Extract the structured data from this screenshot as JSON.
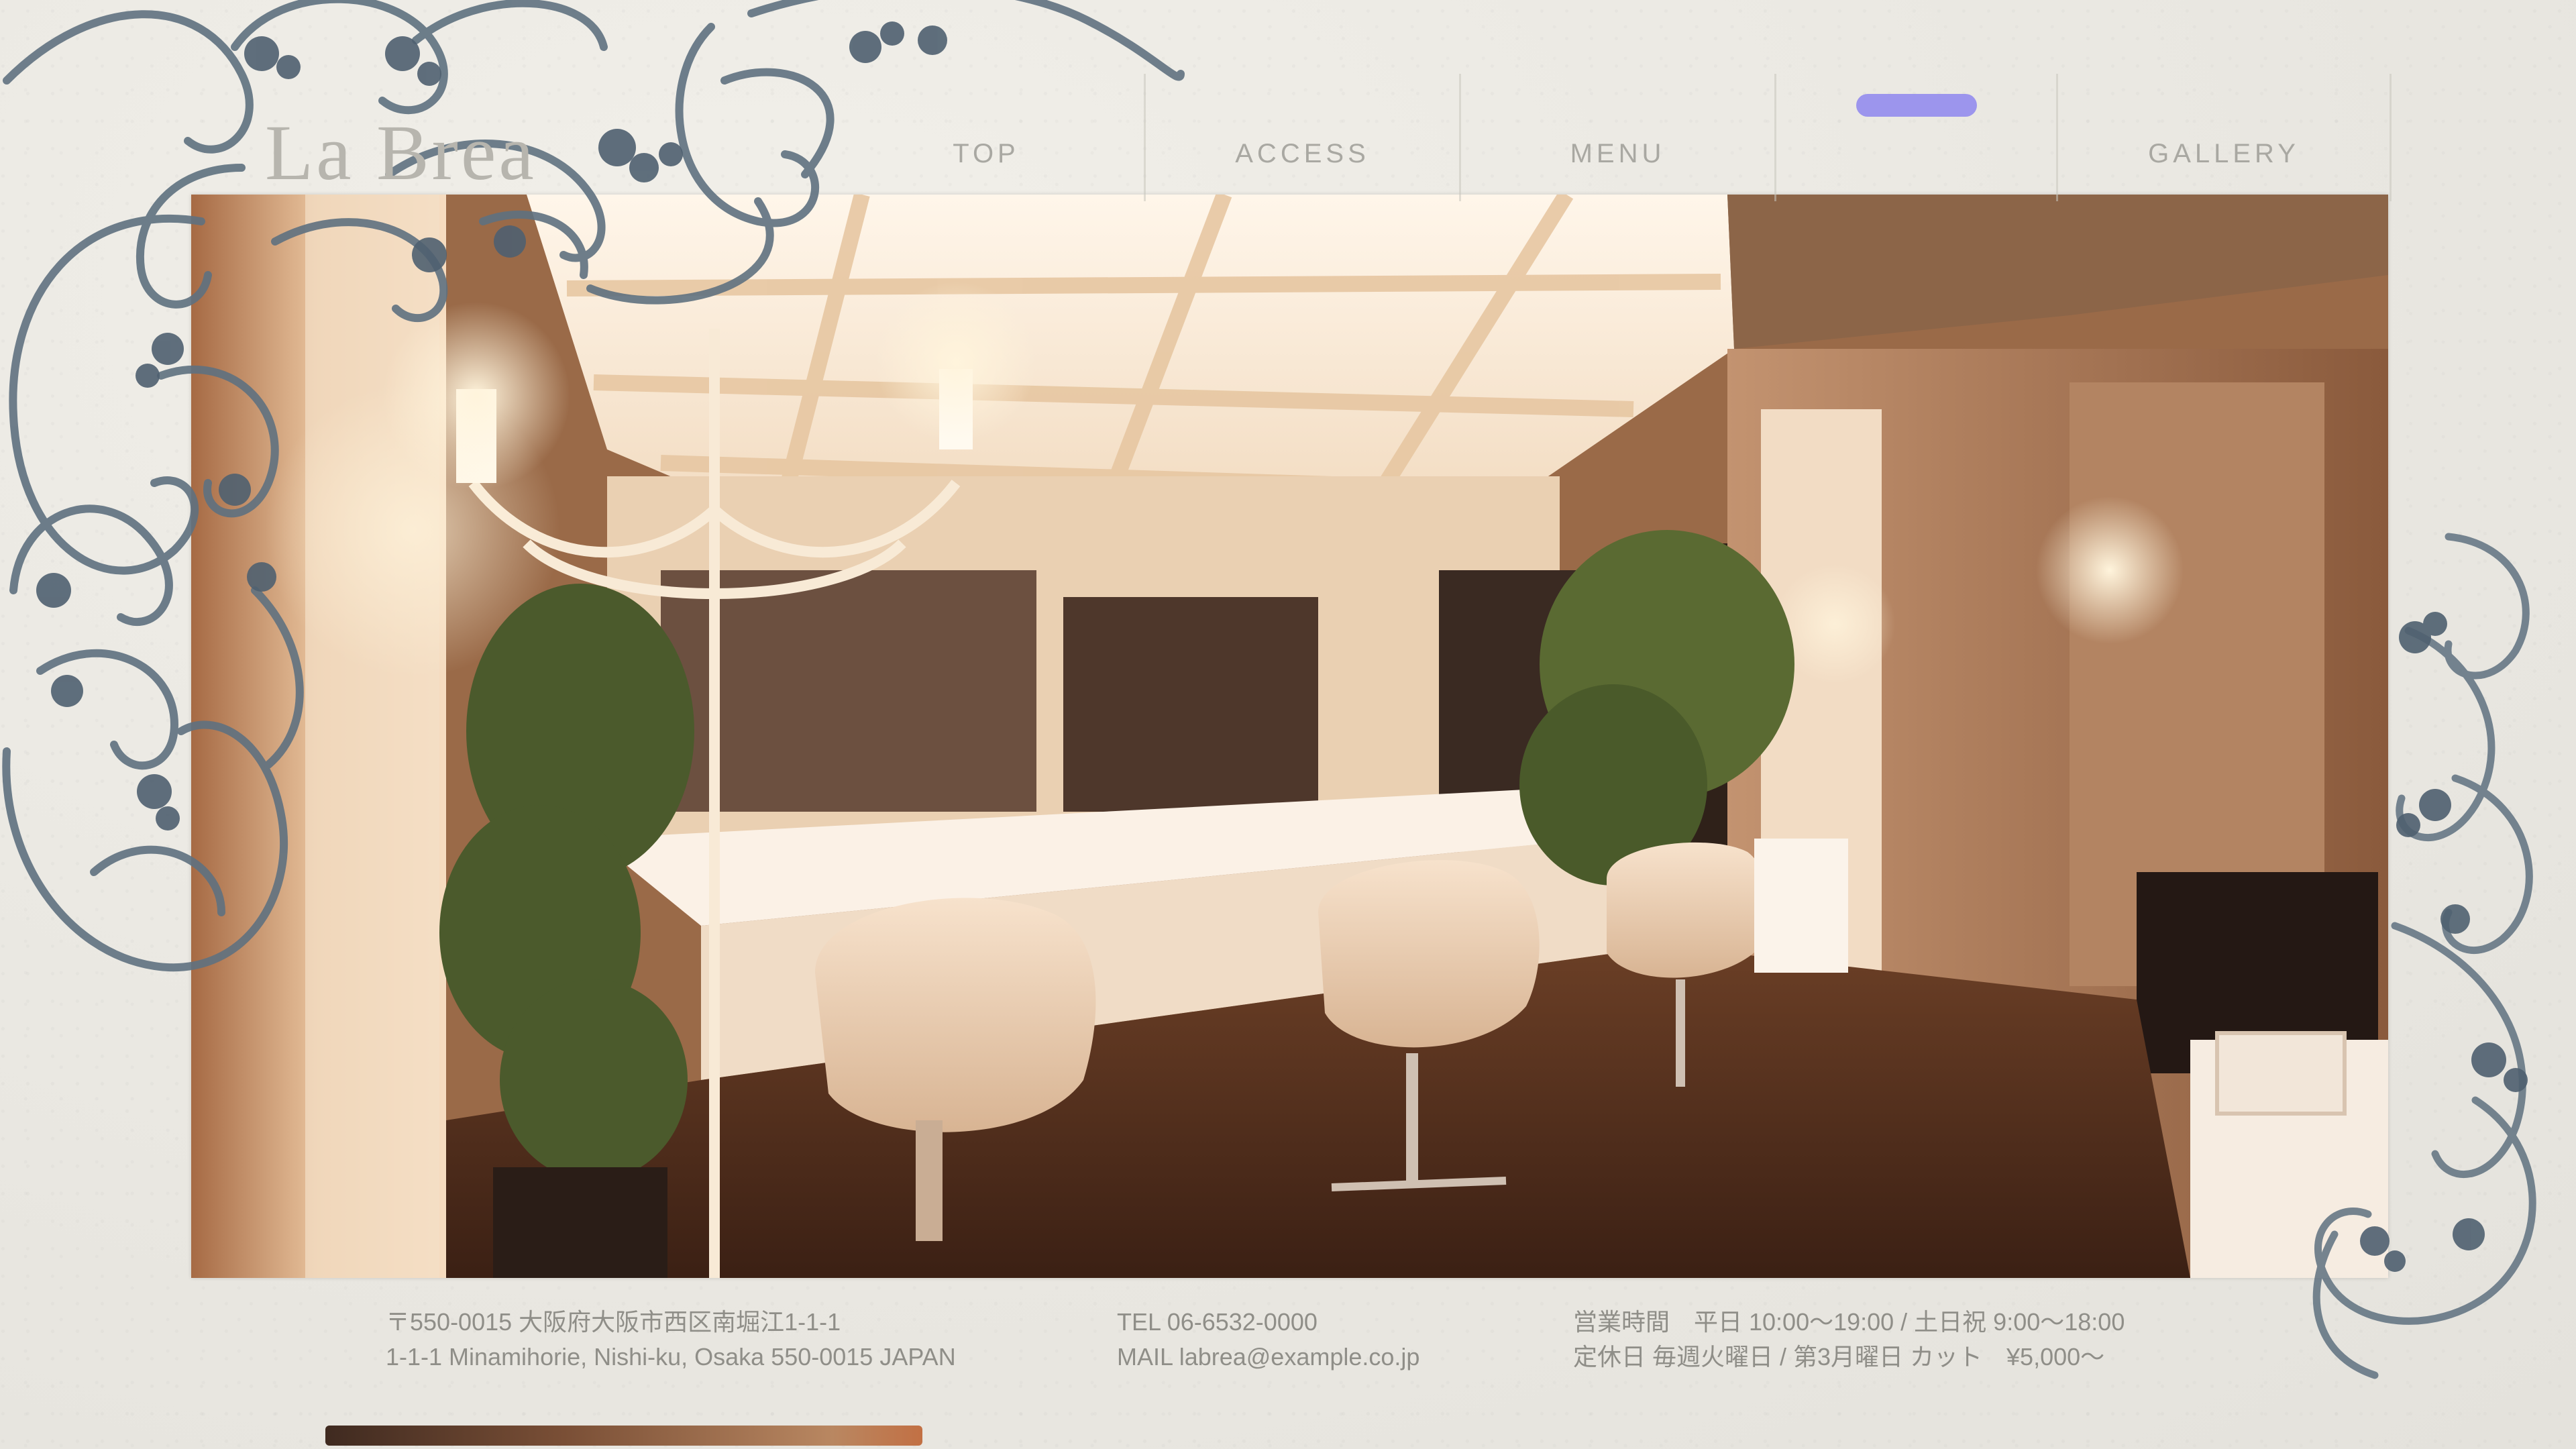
{
  "brand": {
    "logo_text": "La Brea"
  },
  "nav": {
    "items": [
      {
        "label": "TOP"
      },
      {
        "label": "ACCESS"
      },
      {
        "label": "MENU"
      },
      {
        "label": ""
      },
      {
        "label": "GALLERY"
      }
    ],
    "active_index": 3,
    "active_color": "#8e86ee"
  },
  "hero": {
    "alt": "Salon interior with chandelier and styling chairs"
  },
  "footer": {
    "address_line1": "〒550-0015 大阪府大阪市西区南堀江1-1-1",
    "address_line2": "1-1-1 Minamihorie, Nishi-ku, Osaka 550-0015 JAPAN",
    "tel_line": "TEL 06-6532-0000",
    "mail_line": "MAIL labrea@example.co.jp",
    "hours_line1": "営業時間　平日 10:00〜19:00 / 土日祝 9:00〜18:00",
    "hours_line2": "定休日 毎週火曜日 / 第3月曜日 カット　¥5,000〜"
  },
  "colors": {
    "background": "#eceae4",
    "ornament": "#5f7180",
    "text": "#8f8e88"
  },
  "icons": [
    "swirl-ornament-icon"
  ]
}
